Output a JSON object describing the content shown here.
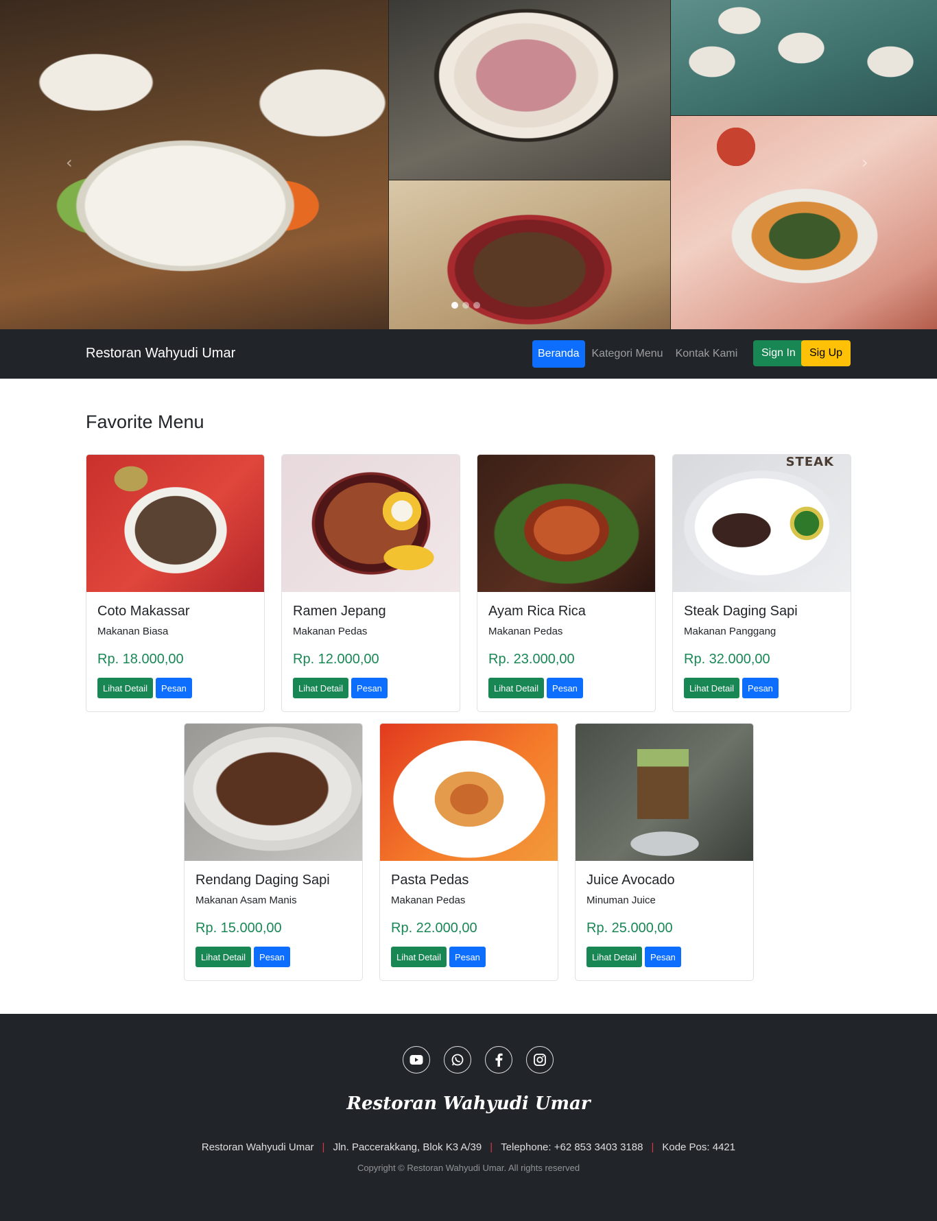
{
  "navbar": {
    "brand": "Restoran Wahyudi Umar",
    "links": [
      {
        "label": "Beranda",
        "active": true
      },
      {
        "label": "Kategori Menu",
        "active": false
      },
      {
        "label": "Kontak Kami",
        "active": false
      }
    ],
    "signin_label": "Sign In",
    "signup_label": "Sig Up"
  },
  "hero": {
    "slide_count": 3,
    "active_slide": 1
  },
  "main": {
    "title": "Favorite Menu",
    "menu_items": [
      {
        "name": "Coto Makassar",
        "category": "Makanan Biasa",
        "price": "Rp. 18.000,00",
        "detail_label": "Lihat Detail",
        "order_label": "Pesan"
      },
      {
        "name": "Ramen Jepang",
        "category": "Makanan Pedas",
        "price": "Rp. 12.000,00",
        "detail_label": "Lihat Detail",
        "order_label": "Pesan"
      },
      {
        "name": "Ayam Rica Rica",
        "category": "Makanan Pedas",
        "price": "Rp. 23.000,00",
        "detail_label": "Lihat Detail",
        "order_label": "Pesan"
      },
      {
        "name": "Steak Daging Sapi",
        "category": "Makanan Panggang",
        "price": "Rp. 32.000,00",
        "detail_label": "Lihat Detail",
        "order_label": "Pesan",
        "image_text": "STEAK"
      },
      {
        "name": "Rendang Daging Sapi",
        "category": "Makanan Asam Manis",
        "price": "Rp. 15.000,00",
        "detail_label": "Lihat Detail",
        "order_label": "Pesan"
      },
      {
        "name": "Pasta Pedas",
        "category": "Makanan Pedas",
        "price": "Rp. 22.000,00",
        "detail_label": "Lihat Detail",
        "order_label": "Pesan"
      },
      {
        "name": "Juice Avocado",
        "category": "Minuman Juice",
        "price": "Rp. 25.000,00",
        "detail_label": "Lihat Detail",
        "order_label": "Pesan"
      }
    ]
  },
  "footer": {
    "social_icons": [
      "youtube-icon",
      "whatsapp-icon",
      "facebook-icon",
      "instagram-icon"
    ],
    "brand": "Restoran Wahyudi Umar",
    "info": {
      "name": "Restoran Wahyudi Umar",
      "address": "Jln. Paccerakkang, Blok K3 A/39",
      "telephone": "Telephone: +62 853 3403 3188",
      "postal": "Kode Pos: 4421"
    },
    "copyright": "Copyright © Restoran Wahyudi Umar. All rights reserved"
  },
  "colors": {
    "navbar_bg": "#212529",
    "primary": "#0d6efd",
    "success": "#198754",
    "warning": "#ffc107",
    "separator": "#dc3545"
  }
}
